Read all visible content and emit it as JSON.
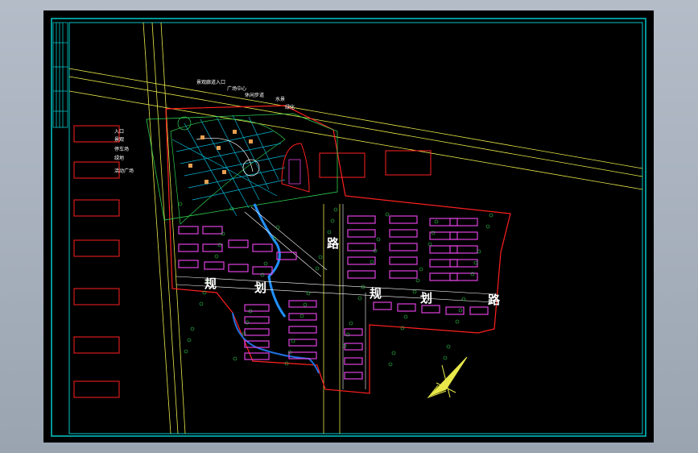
{
  "drawing": {
    "road_labels": [
      "规",
      "划",
      "路",
      "规",
      "划",
      "路"
    ],
    "callouts_top": [
      "景观廊道入口",
      "广场中心",
      "休闲步道",
      "水景",
      "绿化"
    ],
    "callouts_left": [
      "入口",
      "景观",
      "停车场",
      "绿地",
      "活动广场"
    ]
  },
  "colors": {
    "frame": "#00c8c8",
    "road": "#e8e84a",
    "boundary": "#ff2020",
    "building": "#e040e0",
    "green": "#30d050"
  }
}
